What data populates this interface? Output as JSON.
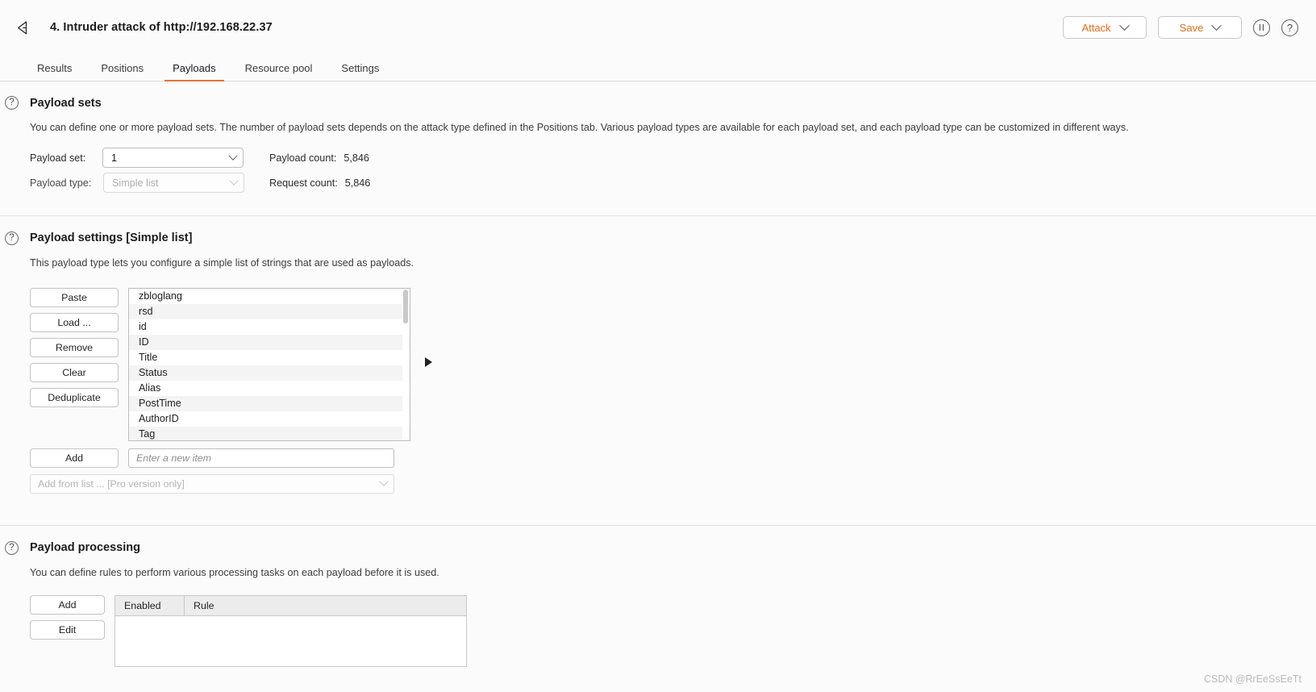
{
  "titlebar": {
    "back_icon": "back-arrow-icon",
    "title": "4. Intruder attack of http://192.168.22.37",
    "attack_button": "Attack",
    "save_button": "Save",
    "pause_icon": "pause-icon",
    "help_icon": "help-icon"
  },
  "tabs": [
    {
      "label": "Results",
      "active": false
    },
    {
      "label": "Positions",
      "active": false
    },
    {
      "label": "Payloads",
      "active": true
    },
    {
      "label": "Resource pool",
      "active": false
    },
    {
      "label": "Settings",
      "active": false
    }
  ],
  "payload_sets": {
    "title": "Payload sets",
    "description": "You can define one or more payload sets. The number of payload sets depends on the attack type defined in the Positions tab. Various payload types are available for each payload set, and each payload type can be customized in different ways.",
    "payload_set_label": "Payload set:",
    "payload_set_value": "1",
    "payload_type_label": "Payload type:",
    "payload_type_value": "Simple list",
    "payload_count_label": "Payload count:",
    "payload_count_value": "5,846",
    "request_count_label": "Request count:",
    "request_count_value": "5,846"
  },
  "payload_settings": {
    "title": "Payload settings [Simple list]",
    "description": "This payload type lets you configure a simple list of strings that are used as payloads.",
    "buttons": [
      "Paste",
      "Load ...",
      "Remove",
      "Clear",
      "Deduplicate"
    ],
    "items": [
      "zbloglang",
      "rsd",
      "id",
      "ID",
      "Title",
      "Status",
      "Alias",
      "PostTime",
      "AuthorID",
      "Tag"
    ],
    "add_button": "Add",
    "add_placeholder": "Enter a new item",
    "add_value": "",
    "from_list_label": "Add from list ... [Pro version only]"
  },
  "payload_processing": {
    "title": "Payload processing",
    "description": "You can define rules to perform various processing tasks on each payload before it is used.",
    "buttons": [
      "Add",
      "Edit"
    ],
    "columns": [
      "Enabled",
      "Rule"
    ],
    "rows": []
  },
  "watermark": "CSDN @RrEeSsEeTt",
  "colors": {
    "accent": "#e8703a",
    "button_text": "#e06c1f",
    "background": "#fbfbfb"
  }
}
